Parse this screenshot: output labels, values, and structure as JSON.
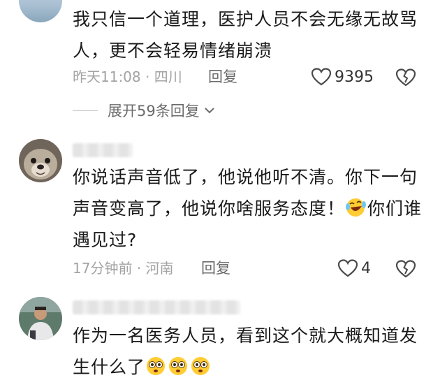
{
  "comments": [
    {
      "text": "我只信一个道理，医护人员不会无缘无故骂人，更不会轻易情绪崩溃",
      "time_location": "昨天11:08 · 四川",
      "reply_label": "回复",
      "like_count": "9395",
      "expand_label": "展开59条回复"
    },
    {
      "text_before_emoji": "你说话声音低了，他说他听不清。你下一句声音变高了，他说你啥服务态度！",
      "text_after_emoji": "你们谁遇见过?",
      "time_location": "17分钟前 · 河南",
      "reply_label": "回复",
      "like_count": "4"
    },
    {
      "text": "作为一名医务人员，看到这个就大概知道发生什么了"
    }
  ],
  "colors": {
    "text": "#1a1a1a",
    "meta": "#a3a3a3",
    "action": "#6b6b6b"
  },
  "icons": [
    "heart-outline-icon",
    "broken-heart-icon",
    "chevron-down-icon",
    "laughing-tears-emoji",
    "flushed-face-emoji"
  ]
}
